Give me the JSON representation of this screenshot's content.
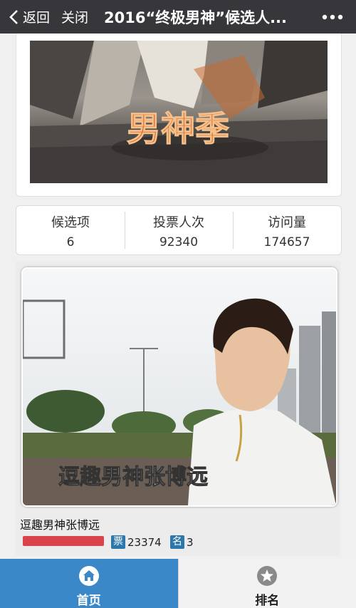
{
  "nav": {
    "back_label": "返回",
    "close_label": "关闭",
    "title": "2016“终极男神”候选人...",
    "more_icon": "more-dots-icon"
  },
  "banner": {
    "text": "男神季"
  },
  "stats": [
    {
      "label": "候选项",
      "value": "6"
    },
    {
      "label": "投票人次",
      "value": "92340"
    },
    {
      "label": "访问量",
      "value": "174657"
    }
  ],
  "candidate": {
    "photo_caption": "逗趣男神张博远",
    "name": "逗趣男神张博远",
    "votes_badge": "票",
    "votes": "23374",
    "rank_badge": "名",
    "rank": "3"
  },
  "tabs": [
    {
      "label": "首页",
      "icon": "home-icon",
      "active": true
    },
    {
      "label": "排名",
      "icon": "star-icon",
      "active": false
    }
  ],
  "colors": {
    "topbar": "#37373b",
    "tab_active": "#3a88c8",
    "badge": "#2e77aa",
    "vote_bar": "#d9434c"
  }
}
